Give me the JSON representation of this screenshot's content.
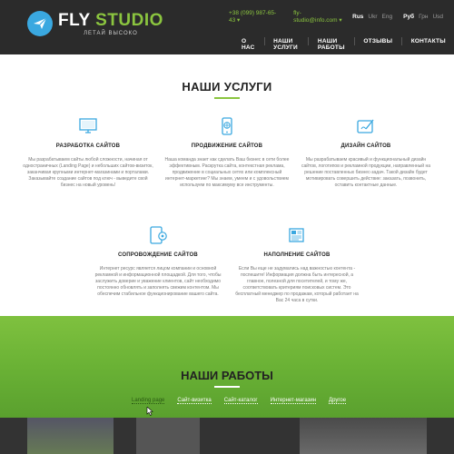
{
  "brand": {
    "name_white": "FLY",
    "name_green": "STUDIO",
    "tagline": "ЛЕТАЙ ВЫСОКО"
  },
  "contact": {
    "phone": "+38 (099) 987-65-43 ▾",
    "email": "fly-studio@info.com ▾"
  },
  "languages": [
    {
      "label": "Rus",
      "active": true
    },
    {
      "label": "Ukr"
    },
    {
      "label": "Eng"
    }
  ],
  "currencies": [
    {
      "label": "Руб",
      "active": true
    },
    {
      "label": "Грн"
    },
    {
      "label": "Usd"
    }
  ],
  "nav": [
    "О НАС",
    "НАШИ УСЛУГИ",
    "НАШИ РАБОТЫ",
    "ОТЗЫВЫ",
    "КОНТАКТЫ"
  ],
  "services_title": "НАШИ УСЛУГИ",
  "services": [
    {
      "icon": "monitor-icon",
      "title": "РАЗРАБОТКА САЙТОВ",
      "desc": "Мы разрабатываем сайты любой сложности, начиная от одностраничных (Landing Page) и небольших сайтов-визиток, заканчивая крупными интернет-магазинами и порталами. Заказывайте создание сайтов под ключ - выведите свой бизнес на новый уровень!"
    },
    {
      "icon": "phone-globe-icon",
      "title": "ПРОДВИЖЕНИЕ САЙТОВ",
      "desc": "Наша команда знает как сделать Ваш бизнес в сети более эффективным. Раскрутка сайта, контекстная реклама, продвижение в социальных сетях или комплексный интернет-маркетинг? Мы знаем, умеем и с удовольствием используем по максимуму все инструменты."
    },
    {
      "icon": "tablet-pen-icon",
      "title": "ДИЗАЙН САЙТОВ",
      "desc": "Мы разрабатываем красивый и функциональный дизайн сайтов, логотипов и рекламной продукции, направленный на решение поставленных бизнес-задач. Такой дизайн будет мотивировать совершить действие: заказать, позвонить, оставить контактные данные."
    },
    {
      "icon": "tablet-gear-icon",
      "title": "СОПРОВОЖДЕНИЕ САЙТОВ",
      "desc": "Интернет ресурс является лицом компании и основной рекламной и информационной площадкой. Для того, чтобы заслужить доверие и уважение клиентов, сайт необходимо постоянно обновлять и заполнять свежим контентом. Мы обеспечим стабильное функционирование вашего сайта."
    },
    {
      "icon": "newspaper-icon",
      "title": "НАПОЛНЕНИЕ САЙТОВ",
      "desc": "Если Вы еще не задумались над важностью контента - поспешите! Информация должна быть интересной, а главное, полезной для посетителей, и тому же, соответствовать критериям поисковых систем. Это бесплатный менеджер по продажам, который работает на Вас 24 часа в сутки."
    }
  ],
  "works_title": "НАШИ РАБОТЫ",
  "filters": [
    {
      "label": "Landing page",
      "active": true
    },
    {
      "label": "Сайт-визитка"
    },
    {
      "label": "Сайт-каталог"
    },
    {
      "label": "Интернет-магазин"
    },
    {
      "label": "Другое"
    }
  ],
  "colors": {
    "accent": "#8bc53f",
    "icon_blue": "#3aa8e0",
    "header_bg": "#2b2b2b"
  }
}
